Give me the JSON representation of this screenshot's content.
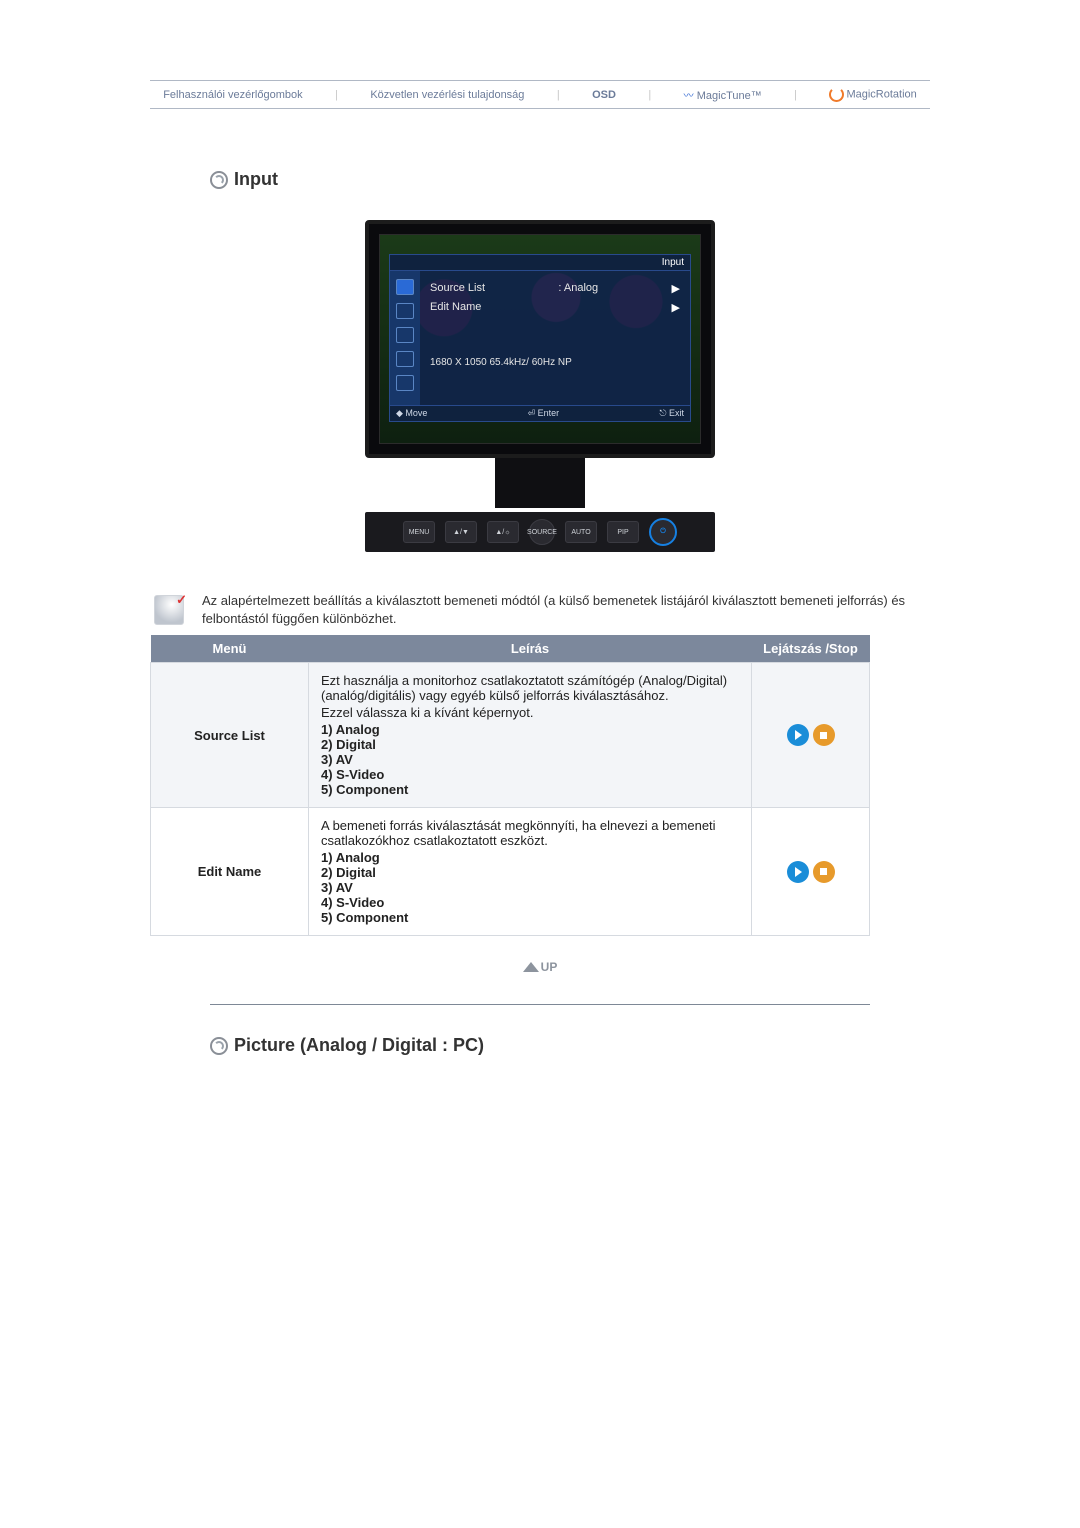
{
  "topbar": {
    "items": [
      "Felhasználói vezérlőgombok",
      "Közvetlen vezérlési tulajdonság",
      "OSD",
      "MagicTune™",
      "MagicRotation"
    ]
  },
  "sections": {
    "input_title": "Input",
    "picture_title": "Picture (Analog / Digital : PC)"
  },
  "osd": {
    "title": "Input",
    "rows": {
      "source_label": "Source List",
      "source_value": ": Analog",
      "edit_label": "Edit Name"
    },
    "resolution": "1680 X 1050  65.4kHz/  60Hz  NP",
    "foot": {
      "move": "Move",
      "enter": "Enter",
      "exit": "Exit"
    }
  },
  "base_buttons": [
    "MENU",
    "▲/▼",
    "▲/☼",
    "SOURCE",
    "AUTO",
    "PIP",
    "⏻"
  ],
  "intro": "Az alapértelmezett beállítás a kiválasztott bemeneti módtól (a külső bemenetek listájáról kiválasztott bemeneti jelforrás) és felbontástól függően különbözhet.",
  "table": {
    "headers": {
      "menu": "Menü",
      "desc": "Leírás",
      "play": "Lejátszás /Stop"
    },
    "rows": [
      {
        "menu": "Source List",
        "desc_lines": [
          "Ezt használja a monitorhoz csatlakoztatott számítógép (Analog/Digital) (analóg/digitális) vagy egyéb külső jelforrás kiválasztásához.",
          "Ezzel válassza ki a kívánt képernyot."
        ],
        "list": [
          "1) Analog",
          "2) Digital",
          "3) AV",
          "4) S-Video",
          "5) Component"
        ]
      },
      {
        "menu": "Edit Name",
        "desc_lines": [
          "A bemeneti forrás kiválasztását megkönnyíti, ha elnevezi a bemeneti csatlakozókhoz csatlakoztatott eszközt."
        ],
        "list": [
          "1) Analog",
          "2) Digital",
          "3) AV",
          "4) S-Video",
          "5) Component"
        ]
      }
    ]
  },
  "up_label": "UP"
}
